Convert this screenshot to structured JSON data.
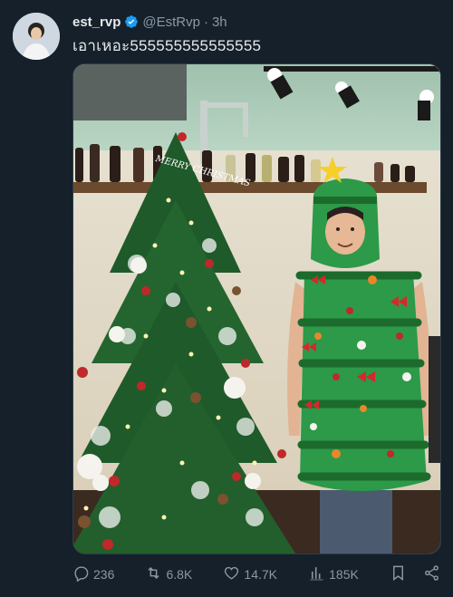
{
  "tweet": {
    "display_name": "est_rvp",
    "handle": "@EstRvp",
    "separator": "·",
    "time": "3h",
    "text": "เอาเหอะ555555555555555"
  },
  "media": {
    "sign_text": "MERRY CHRISTMAS"
  },
  "actions": {
    "replies": "236",
    "reposts": "6.8K",
    "likes": "14.7K",
    "views": "185K"
  },
  "icons": {
    "verified": "verified-badge-icon",
    "reply": "reply-icon",
    "repost": "repost-icon",
    "like": "heart-icon",
    "views": "views-icon",
    "bookmark": "bookmark-icon",
    "share": "share-icon"
  },
  "colors": {
    "background": "#15202b",
    "verified": "#1d9bf0",
    "muted": "#8b98a5",
    "text": "#e7e9ea"
  }
}
